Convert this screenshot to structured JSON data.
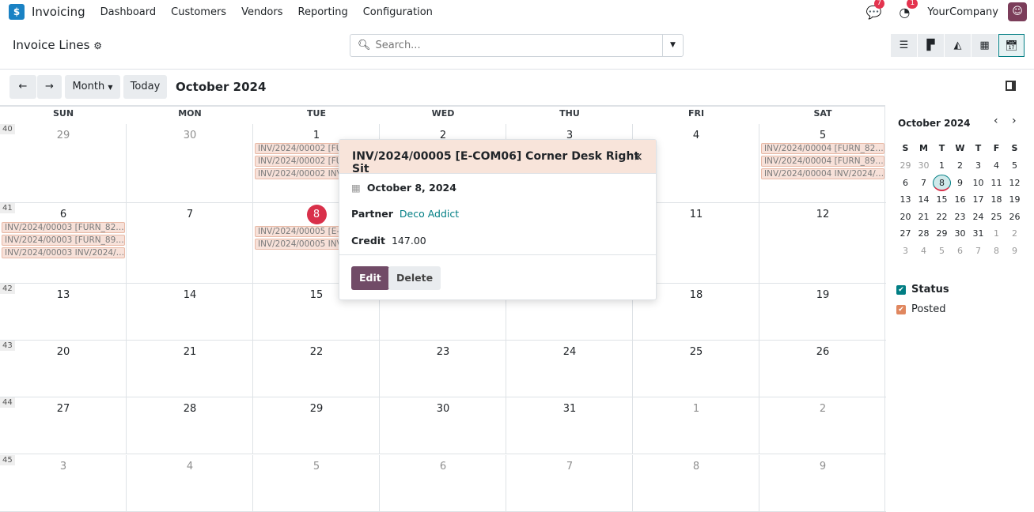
{
  "nav": {
    "app": "Invoicing",
    "menus": [
      "Dashboard",
      "Customers",
      "Vendors",
      "Reporting",
      "Configuration"
    ],
    "messages_count": "7",
    "activities_count": "1",
    "company": "YourCompany"
  },
  "control": {
    "title": "Invoice Lines",
    "search_placeholder": "Search...",
    "views": [
      "list",
      "kanban",
      "graph",
      "pivot",
      "calendar"
    ],
    "active_view": "calendar"
  },
  "toolbar": {
    "prev": "←",
    "next": "→",
    "scale": "Month",
    "today": "Today",
    "period": "October 2024"
  },
  "calendar": {
    "weekdays": [
      "SUN",
      "MON",
      "TUE",
      "WED",
      "THU",
      "FRI",
      "SAT"
    ],
    "weeks": [
      {
        "num": "40",
        "days": [
          [
            "29",
            true
          ],
          [
            "30",
            true
          ],
          [
            "1",
            false
          ],
          [
            "2",
            false
          ],
          [
            "3",
            false
          ],
          [
            "4",
            false
          ],
          [
            "5",
            false
          ]
        ]
      },
      {
        "num": "41",
        "days": [
          [
            "6",
            false
          ],
          [
            "7",
            false
          ],
          [
            "8",
            false
          ],
          [
            "9",
            false
          ],
          [
            "10",
            false
          ],
          [
            "11",
            false
          ],
          [
            "12",
            false
          ]
        ]
      },
      {
        "num": "42",
        "days": [
          [
            "13",
            false
          ],
          [
            "14",
            false
          ],
          [
            "15",
            false
          ],
          [
            "16",
            false
          ],
          [
            "17",
            false
          ],
          [
            "18",
            false
          ],
          [
            "19",
            false
          ]
        ]
      },
      {
        "num": "43",
        "days": [
          [
            "20",
            false
          ],
          [
            "21",
            false
          ],
          [
            "22",
            false
          ],
          [
            "23",
            false
          ],
          [
            "24",
            false
          ],
          [
            "25",
            false
          ],
          [
            "26",
            false
          ]
        ]
      },
      {
        "num": "44",
        "days": [
          [
            "27",
            false
          ],
          [
            "28",
            false
          ],
          [
            "29",
            false
          ],
          [
            "30",
            false
          ],
          [
            "31",
            false
          ],
          [
            "1",
            true
          ],
          [
            "2",
            true
          ]
        ]
      },
      {
        "num": "45",
        "days": [
          [
            "3",
            true
          ],
          [
            "4",
            true
          ],
          [
            "5",
            true
          ],
          [
            "6",
            true
          ],
          [
            "7",
            true
          ],
          [
            "8",
            true
          ],
          [
            "9",
            true
          ]
        ]
      }
    ],
    "today": "8",
    "events": [
      {
        "week": 0,
        "day": 2,
        "items": [
          "INV/2024/00002 [FURN_82…",
          "INV/2024/00002 [FURN_89…",
          "INV/2024/00002 INV/2024/…"
        ]
      },
      {
        "week": 0,
        "day": 6,
        "items": [
          "INV/2024/00004 [FURN_82…",
          "INV/2024/00004 [FURN_89…",
          "INV/2024/00004 INV/2024/…"
        ]
      },
      {
        "week": 1,
        "day": 0,
        "items": [
          "INV/2024/00003 [FURN_82…",
          "INV/2024/00003 [FURN_89…",
          "INV/2024/00003 INV/2024/…"
        ]
      },
      {
        "week": 1,
        "day": 2,
        "items": [
          "INV/2024/00005 [E-COM06]…",
          "INV/2024/00005 INV/2024/…"
        ]
      }
    ]
  },
  "popover": {
    "title": "INV/2024/00005 [E-COM06] Corner Desk Right Sit",
    "date": "October 8, 2024",
    "partner_label": "Partner",
    "partner": "Deco Addict",
    "credit_label": "Credit",
    "credit": "147.00",
    "edit": "Edit",
    "delete": "Delete"
  },
  "sidebar": {
    "month": "October 2024",
    "weekdays": [
      "S",
      "M",
      "T",
      "W",
      "T",
      "F",
      "S"
    ],
    "weeks": [
      [
        "29",
        "30",
        "1",
        "2",
        "3",
        "4",
        "5"
      ],
      [
        "6",
        "7",
        "8",
        "9",
        "10",
        "11",
        "12"
      ],
      [
        "13",
        "14",
        "15",
        "16",
        "17",
        "18",
        "19"
      ],
      [
        "20",
        "21",
        "22",
        "23",
        "24",
        "25",
        "26"
      ],
      [
        "27",
        "28",
        "29",
        "30",
        "31",
        "1",
        "2"
      ],
      [
        "3",
        "4",
        "5",
        "6",
        "7",
        "8",
        "9"
      ]
    ],
    "filter_title": "Status",
    "filters": [
      {
        "label": "Posted",
        "color": "#e0875f"
      }
    ],
    "filter_title_color": "#017e84"
  },
  "colors": {
    "accent": "#714b67",
    "teal": "#017e84",
    "today": "#d9304a"
  }
}
